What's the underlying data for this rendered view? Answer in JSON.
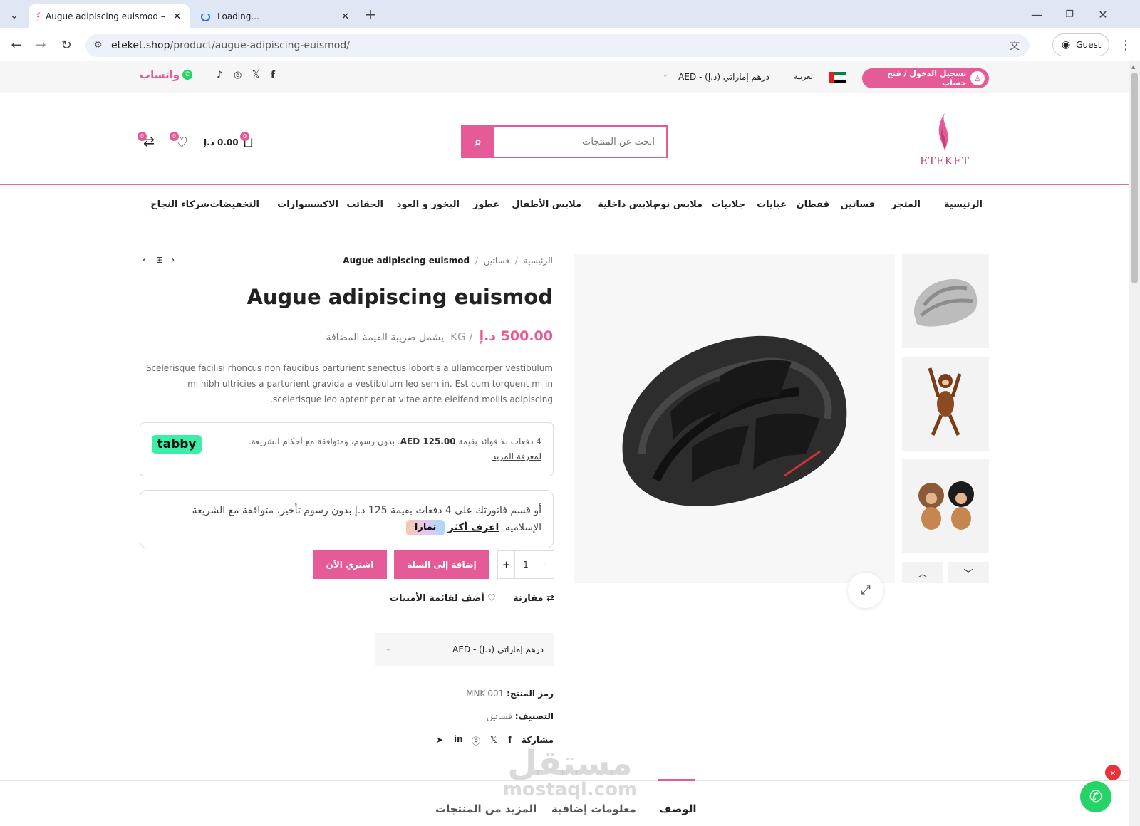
{
  "browser": {
    "tabs": [
      {
        "title": "Augue adipiscing euismod – إ ت",
        "active": true
      },
      {
        "title": "Loading...",
        "active": false
      }
    ],
    "url_host": "eteket.shop",
    "url_path": "/product/augue-adipiscing-euismod/",
    "profile_label": "Guest"
  },
  "topbar": {
    "login_label": "تسجيل الدخول / فتح حساب",
    "language": "العربية",
    "currency": "درهم إماراتي (د.إ) - AED",
    "whatsapp": "واتساب"
  },
  "header": {
    "brand": "ETEKET",
    "search_placeholder": "ابحث عن المنتجات",
    "cart_total": "0.00 د.إ",
    "cart_count": "0",
    "wishlist_count": "0",
    "compare_count": "0"
  },
  "nav": [
    "الرئيسية",
    "المتجر",
    "فساتين",
    "قفطان",
    "عبايات",
    "جلابيات",
    "ملابس نوم",
    "ملابس داخلية",
    "ملابس الأطفال",
    "عطور",
    "البخور و العود",
    "الحقائب",
    "الاكسسوارات",
    "التخفيضات",
    "شركاء النجاح"
  ],
  "breadcrumb": {
    "home": "الرئيسية",
    "sep": "/",
    "category": "فساتين",
    "current": "Augue adipiscing euismod"
  },
  "product": {
    "title": "Augue adipiscing euismod",
    "price": "500.00 د.إ",
    "unit": "/ KG",
    "tax_note": "يشمل ضريبة القيمة المضافة",
    "description": "Scelerisque facilisi rhoncus non faucibus parturient senectus lobortis a ullamcorper vestibulum mi nibh ultricies a parturient gravida a vestibulum leo sem in. Est cum torquent mi in scelerisque leo aptent per at vitae ante eleifend mollis adipiscing.",
    "quantity": "1",
    "qty_minus": "-",
    "qty_plus": "+",
    "add_to_cart": "إضافة إلى السلة",
    "buy_now": "اشتري الآن",
    "compare": "مقارنة",
    "wishlist": "أضف لقائمة الأمنيات",
    "currency_select": "درهم إماراتي (د.إ) - AED",
    "sku_label": "رمز المنتج:",
    "sku": "MNK-001",
    "category_label": "التصنيف:",
    "category": "فساتين",
    "share_label": "مشاركة"
  },
  "tabby": {
    "logo": "tabby",
    "line1_pre": "4 دفعات بلا فوائد بقيمة",
    "amount": "AED 125.00",
    "line1_post": ". بدون رسوم، ومتوافقة مع أحكام الشريعة.",
    "learn_more": "لمعرفة المزيد"
  },
  "tamara": {
    "text": "أو قسم فاتورتك على 4 دفعات بقيمة 125 د.إ بدون رسوم تأخير، متوافقة مع الشريعة الإسلامية",
    "learn_more": "اعرف أكثر",
    "logo": "تمارا"
  },
  "bottom_tabs": [
    "الوصف",
    "معلومات إضافية",
    "المزيد من المنتجات"
  ],
  "watermark": {
    "ar": "مستقل",
    "en": "mostaql.com"
  },
  "colors": {
    "accent": "#e45b97",
    "tabby": "#3bf0a6"
  }
}
